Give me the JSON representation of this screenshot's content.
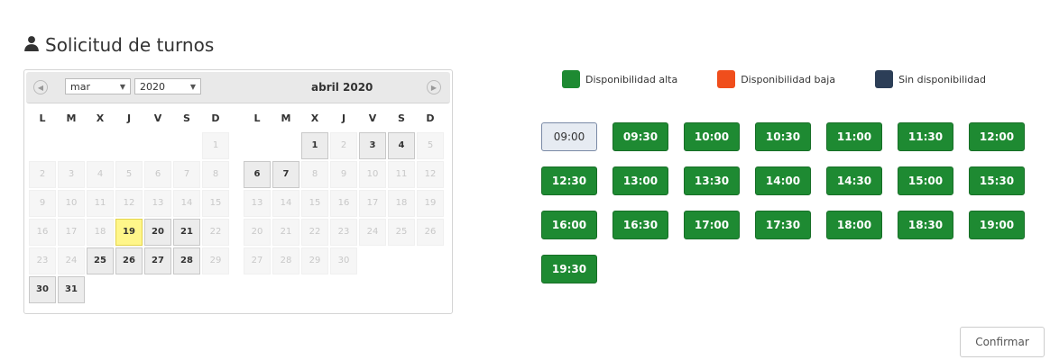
{
  "title": "Solicitud de turnos",
  "icons": {
    "title": "user-icon",
    "prev": "circle-prev-icon",
    "next": "circle-next-icon"
  },
  "datepicker": {
    "month_select": "mar",
    "year_select": "2020",
    "second_title": "abril 2020",
    "dow": [
      "L",
      "M",
      "X",
      "J",
      "V",
      "S",
      "D"
    ],
    "months": [
      {
        "name": "marzo 2020",
        "weeks": [
          [
            {
              "d": "",
              "s": "blank"
            },
            {
              "d": "",
              "s": "blank"
            },
            {
              "d": "",
              "s": "blank"
            },
            {
              "d": "",
              "s": "blank"
            },
            {
              "d": "",
              "s": "blank"
            },
            {
              "d": "",
              "s": "blank"
            },
            {
              "d": "1",
              "s": "disabled"
            }
          ],
          [
            {
              "d": "2",
              "s": "disabled"
            },
            {
              "d": "3",
              "s": "disabled"
            },
            {
              "d": "4",
              "s": "disabled"
            },
            {
              "d": "5",
              "s": "disabled"
            },
            {
              "d": "6",
              "s": "disabled"
            },
            {
              "d": "7",
              "s": "disabled"
            },
            {
              "d": "8",
              "s": "disabled"
            }
          ],
          [
            {
              "d": "9",
              "s": "disabled"
            },
            {
              "d": "10",
              "s": "disabled"
            },
            {
              "d": "11",
              "s": "disabled"
            },
            {
              "d": "12",
              "s": "disabled"
            },
            {
              "d": "13",
              "s": "disabled"
            },
            {
              "d": "14",
              "s": "disabled"
            },
            {
              "d": "15",
              "s": "disabled"
            }
          ],
          [
            {
              "d": "16",
              "s": "disabled"
            },
            {
              "d": "17",
              "s": "disabled"
            },
            {
              "d": "18",
              "s": "disabled"
            },
            {
              "d": "19",
              "s": "today"
            },
            {
              "d": "20",
              "s": "active"
            },
            {
              "d": "21",
              "s": "active"
            },
            {
              "d": "22",
              "s": "disabled"
            }
          ],
          [
            {
              "d": "23",
              "s": "disabled"
            },
            {
              "d": "24",
              "s": "disabled"
            },
            {
              "d": "25",
              "s": "active"
            },
            {
              "d": "26",
              "s": "active"
            },
            {
              "d": "27",
              "s": "active"
            },
            {
              "d": "28",
              "s": "active"
            },
            {
              "d": "29",
              "s": "disabled"
            }
          ],
          [
            {
              "d": "30",
              "s": "active"
            },
            {
              "d": "31",
              "s": "active"
            },
            {
              "d": "",
              "s": "blank"
            },
            {
              "d": "",
              "s": "blank"
            },
            {
              "d": "",
              "s": "blank"
            },
            {
              "d": "",
              "s": "blank"
            },
            {
              "d": "",
              "s": "blank"
            }
          ]
        ]
      },
      {
        "name": "abril 2020",
        "weeks": [
          [
            {
              "d": "",
              "s": "blank"
            },
            {
              "d": "",
              "s": "blank"
            },
            {
              "d": "1",
              "s": "active"
            },
            {
              "d": "2",
              "s": "disabled"
            },
            {
              "d": "3",
              "s": "active"
            },
            {
              "d": "4",
              "s": "active"
            },
            {
              "d": "5",
              "s": "disabled"
            }
          ],
          [
            {
              "d": "6",
              "s": "active"
            },
            {
              "d": "7",
              "s": "active"
            },
            {
              "d": "8",
              "s": "disabled"
            },
            {
              "d": "9",
              "s": "disabled"
            },
            {
              "d": "10",
              "s": "disabled"
            },
            {
              "d": "11",
              "s": "disabled"
            },
            {
              "d": "12",
              "s": "disabled"
            }
          ],
          [
            {
              "d": "13",
              "s": "disabled"
            },
            {
              "d": "14",
              "s": "disabled"
            },
            {
              "d": "15",
              "s": "disabled"
            },
            {
              "d": "16",
              "s": "disabled"
            },
            {
              "d": "17",
              "s": "disabled"
            },
            {
              "d": "18",
              "s": "disabled"
            },
            {
              "d": "19",
              "s": "disabled"
            }
          ],
          [
            {
              "d": "20",
              "s": "disabled"
            },
            {
              "d": "21",
              "s": "disabled"
            },
            {
              "d": "22",
              "s": "disabled"
            },
            {
              "d": "23",
              "s": "disabled"
            },
            {
              "d": "24",
              "s": "disabled"
            },
            {
              "d": "25",
              "s": "disabled"
            },
            {
              "d": "26",
              "s": "disabled"
            }
          ],
          [
            {
              "d": "27",
              "s": "disabled"
            },
            {
              "d": "28",
              "s": "disabled"
            },
            {
              "d": "29",
              "s": "disabled"
            },
            {
              "d": "30",
              "s": "disabled"
            },
            {
              "d": "",
              "s": "blank"
            },
            {
              "d": "",
              "s": "blank"
            },
            {
              "d": "",
              "s": "blank"
            }
          ]
        ]
      }
    ]
  },
  "legend": [
    {
      "label": "Disponibilidad alta",
      "color": "#1e8a32"
    },
    {
      "label": "Disponibilidad baja",
      "color": "#f04e1c"
    },
    {
      "label": "Sin disponibilidad",
      "color": "#2c3e57"
    }
  ],
  "slots": [
    {
      "time": "09:00",
      "selected": true
    },
    {
      "time": "09:30"
    },
    {
      "time": "10:00"
    },
    {
      "time": "10:30"
    },
    {
      "time": "11:00"
    },
    {
      "time": "11:30"
    },
    {
      "time": "12:00"
    },
    {
      "time": "12:30"
    },
    {
      "time": "13:00"
    },
    {
      "time": "13:30"
    },
    {
      "time": "14:00"
    },
    {
      "time": "14:30"
    },
    {
      "time": "15:00"
    },
    {
      "time": "15:30"
    },
    {
      "time": "16:00"
    },
    {
      "time": "16:30"
    },
    {
      "time": "17:00"
    },
    {
      "time": "17:30"
    },
    {
      "time": "18:00"
    },
    {
      "time": "18:30"
    },
    {
      "time": "19:00"
    },
    {
      "time": "19:30"
    }
  ],
  "confirm_label": "Confirmar"
}
